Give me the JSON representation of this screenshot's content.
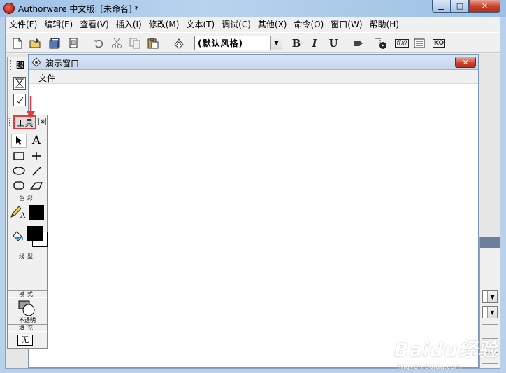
{
  "window": {
    "title": "Authorware 中文版: [未命名] *",
    "min_glyph": "▁",
    "max_glyph": "□",
    "close_glyph": "✕"
  },
  "menubar": [
    "文件(F)",
    "编辑(E)",
    "查看(V)",
    "插入(I)",
    "修改(M)",
    "文本(T)",
    "调试(C)",
    "其他(X)",
    "命令(O)",
    "窗口(W)",
    "帮助(H)"
  ],
  "toolbar": {
    "style_value": "(默认风格)",
    "bold": "B",
    "italic": "I",
    "underline": "U",
    "fx_label": "f(x)",
    "ko_label": "KO"
  },
  "icon_palette": {
    "title": "图"
  },
  "presentation_window": {
    "title": "演示窗口",
    "menu": [
      "文件"
    ],
    "close_glyph": "✕"
  },
  "tools_palette": {
    "title": "工具",
    "close_glyph": "⊠",
    "text_tool": "A",
    "sections": {
      "color": "色彩",
      "line": "线型",
      "mode": "模式",
      "fill": "填充"
    },
    "pen_letter": "A",
    "mode_value": "不透明",
    "fill_value": "无"
  },
  "watermark": {
    "main": "Baidu经验",
    "sub": "jingyan.baidu.com"
  },
  "colors": {
    "annotation": "#e23b3b",
    "close_button": "#c7402b",
    "title_gradient": "#9fc2e6"
  }
}
